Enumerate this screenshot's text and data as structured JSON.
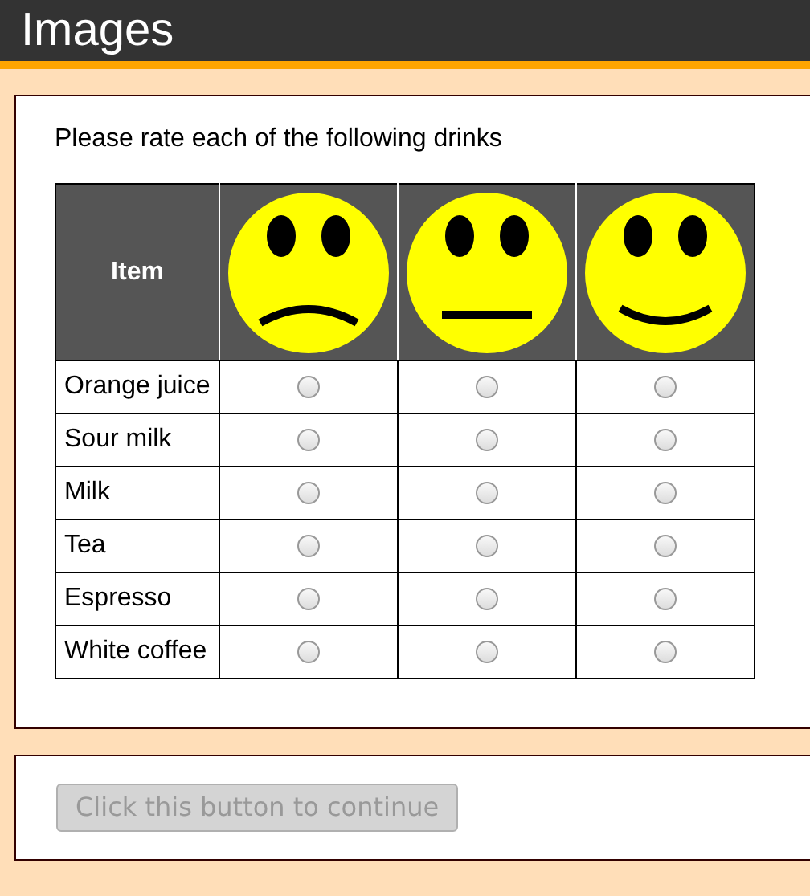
{
  "header": {
    "title": "Images"
  },
  "question": {
    "text": "Please rate each of the following drinks",
    "item_heading": "Item",
    "faces": [
      {
        "kind": "sad"
      },
      {
        "kind": "neutral"
      },
      {
        "kind": "happy"
      }
    ],
    "rows": [
      {
        "label": "Orange juice",
        "options": [
          {
            "selected": false
          },
          {
            "selected": false
          },
          {
            "selected": false
          }
        ]
      },
      {
        "label": "Sour milk",
        "options": [
          {
            "selected": false
          },
          {
            "selected": false
          },
          {
            "selected": false
          }
        ]
      },
      {
        "label": "Milk",
        "options": [
          {
            "selected": false
          },
          {
            "selected": false
          },
          {
            "selected": false
          }
        ]
      },
      {
        "label": "Tea",
        "options": [
          {
            "selected": false
          },
          {
            "selected": false
          },
          {
            "selected": false
          }
        ]
      },
      {
        "label": "Espresso",
        "options": [
          {
            "selected": false
          },
          {
            "selected": false
          },
          {
            "selected": false
          }
        ]
      },
      {
        "label": "White coffee",
        "options": [
          {
            "selected": false
          },
          {
            "selected": false
          },
          {
            "selected": false
          }
        ]
      }
    ]
  },
  "continue_button": {
    "label": "Click this button to continue",
    "disabled": true
  }
}
